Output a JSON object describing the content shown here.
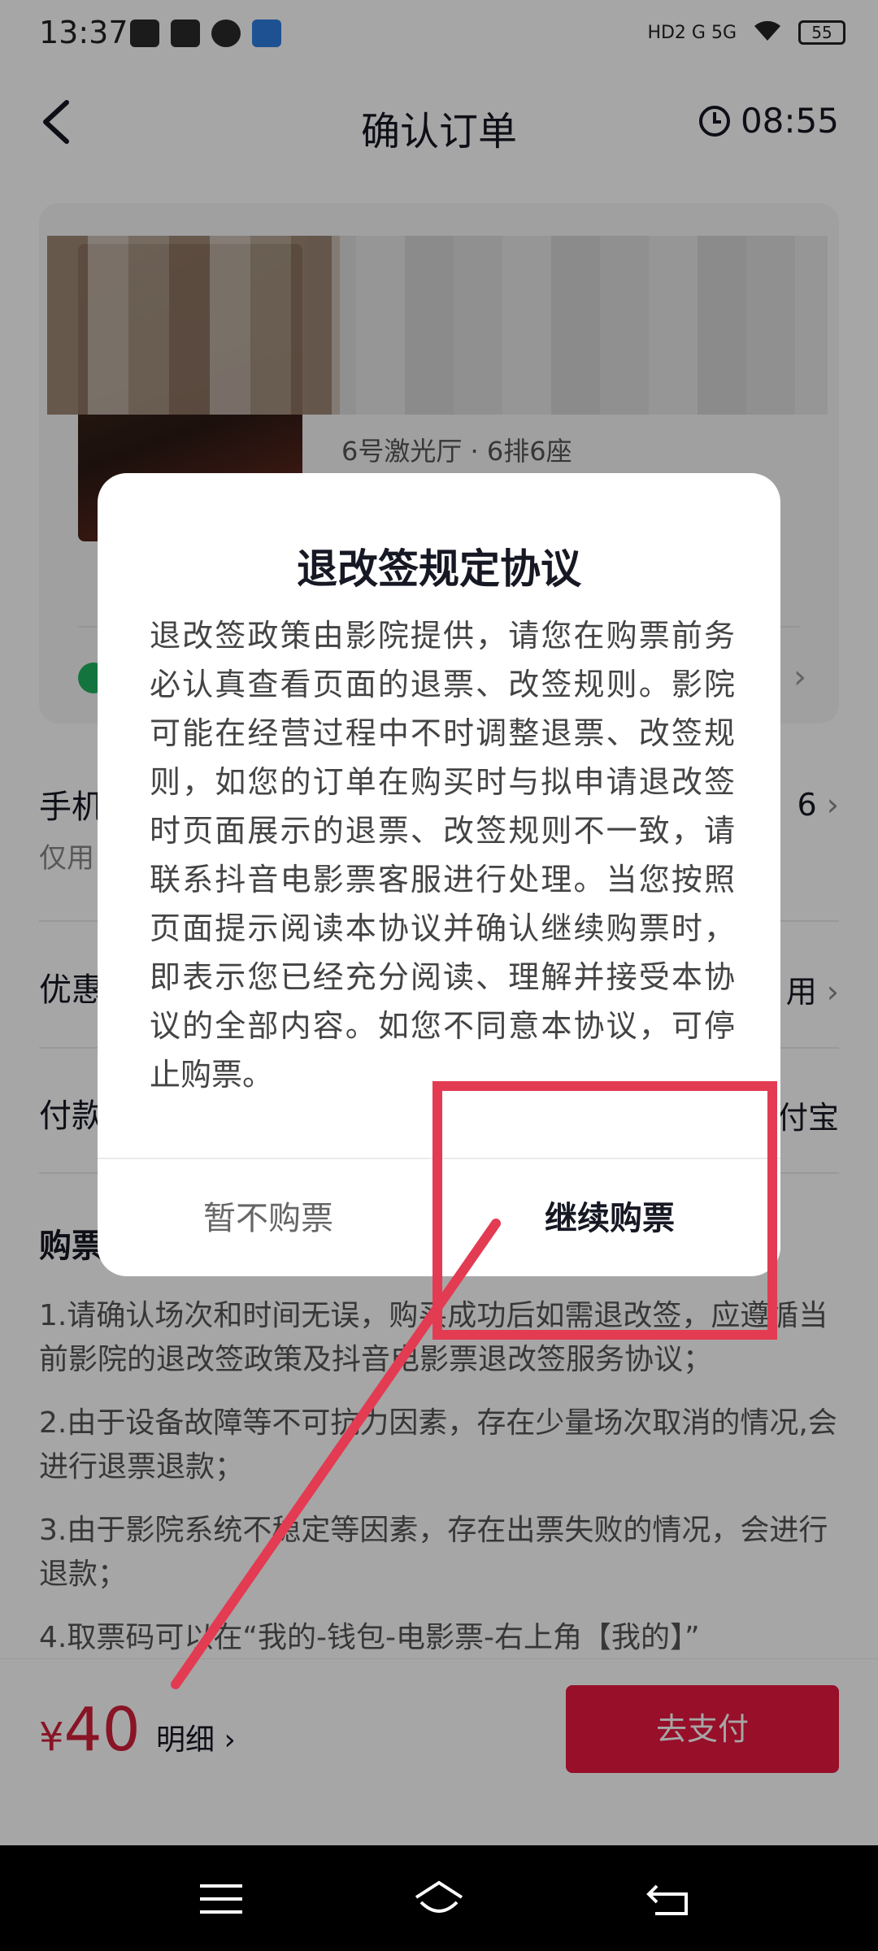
{
  "status_bar": {
    "time": "13:37",
    "network": "HD2 G 5G",
    "battery": "55"
  },
  "header": {
    "title": "确认订单",
    "countdown": "08:55"
  },
  "movie": {
    "hall_seat": "6号激光厅 · 6排6座"
  },
  "rows": {
    "phone_label": "手机号",
    "phone_sub": "仅用",
    "phone_value": "6",
    "coupon_label": "优惠",
    "coupon_value": "用",
    "payment_label": "付款",
    "payment_value": "付宝",
    "notice_label": "购票"
  },
  "notices": [
    "1.请确认场次和时间无误，购买成功后如需退改签，应遵循当前影院的退改签政策及抖音电影票退改签服务协议；",
    "2.由于设备故障等不可抗力因素，存在少量场次取消的情况,会进行退票退款；",
    "3.由于影院系统不稳定等因素，存在出票失败的情况，会进行退款；",
    "4.取票码可以在“我的-钱包-电影票-右上角【我的】”"
  ],
  "bottom_bar": {
    "currency": "¥",
    "price": "40",
    "detail_label": "明细 ›",
    "pay_label": "去支付"
  },
  "dialog": {
    "title": "退改签规定协议",
    "body": "退改签政策由影院提供，请您在购票前务必认真查看页面的退票、改签规则。影院可能在经营过程中不时调整退票、改签规则，如您的订单在购买时与拟申请退改签时页面展示的退票、改签规则不一致，请联系抖音电影票客服进行处理。当您按照页面提示阅读本协议并确认继续购票时，即表示您已经充分阅读、理解并接受本协议的全部内容。如您不同意本协议，可停止购票。",
    "cancel_label": "暂不购票",
    "confirm_label": "继续购票"
  },
  "colors": {
    "accent_red": "#e8183f",
    "price_red": "#d11f3a",
    "annotation_red": "#e33b52",
    "check_green": "#1fb35f"
  },
  "icons": [
    "back-icon",
    "clock-icon",
    "check-icon",
    "chevron-right-icon",
    "menu-icon",
    "home-icon",
    "return-icon"
  ]
}
